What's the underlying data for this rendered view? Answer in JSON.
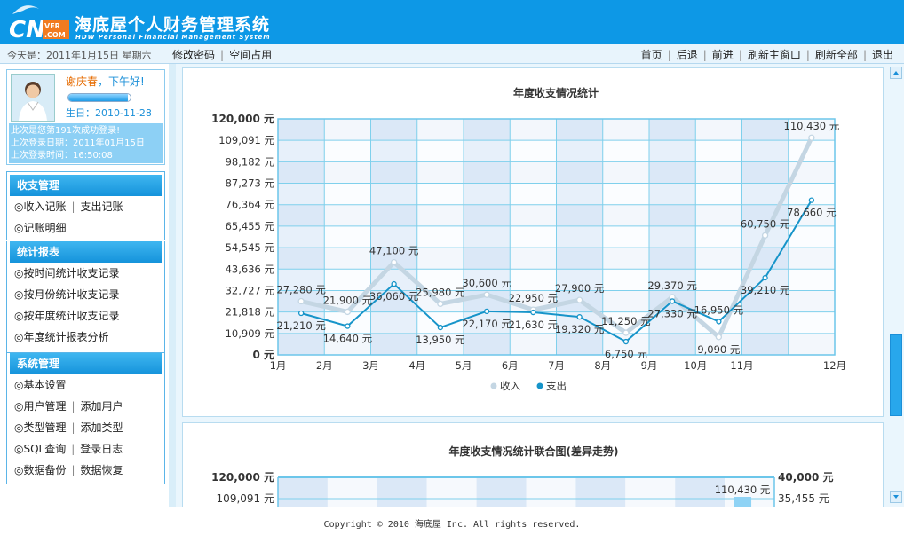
{
  "header": {
    "logo_text": "CN",
    "logo_badge": "VER.COM",
    "title": "海底屋个人财务管理系统",
    "subtitle": "HDW Personal Financial Management System"
  },
  "topbar": {
    "date": "今天是：2011年1月15日  星期六",
    "left_links": [
      "修改密码",
      "空间占用"
    ],
    "right_links": [
      "首页",
      "后退",
      "前进",
      "刷新主窗口",
      "刷新全部",
      "退出"
    ]
  },
  "user": {
    "name": "谢庆春",
    "greeting": "，下午好!",
    "birthday": "生日：2010-11-28",
    "progress": 0.95,
    "login_lines": [
      "此次是您第191次成功登录!",
      "上次登录日期：2011年01月15日",
      "上次登录时间：16:50:08"
    ]
  },
  "menus": [
    {
      "title": "收支管理",
      "rows": [
        [
          "收入记账",
          "支出记账"
        ],
        [
          "记账明细"
        ]
      ]
    },
    {
      "title": "统计报表",
      "rows": [
        [
          "按时间统计收支记录"
        ],
        [
          "按月份统计收支记录"
        ],
        [
          "按年度统计收支记录"
        ],
        [
          "年度统计报表分析"
        ]
      ]
    },
    {
      "title": "系统管理",
      "rows": [
        [
          "基本设置"
        ],
        [
          "用户管理",
          "添加用户"
        ],
        [
          "类型管理",
          "添加类型"
        ],
        [
          "SQL查询",
          "登录日志"
        ],
        [
          "数据备份",
          "数据恢复"
        ]
      ]
    }
  ],
  "colors": {
    "header": "#0d98e6",
    "income": "#c4d6e3",
    "expense": "#1694c9",
    "accent": "#1a8fd8"
  },
  "chart_data": [
    {
      "type": "line",
      "title": "年度收支情况统计",
      "categories": [
        "1月",
        "2月",
        "3月",
        "4月",
        "5月",
        "6月",
        "7月",
        "8月",
        "9月",
        "10月",
        "11月",
        "12月"
      ],
      "yticks": [
        "0 元",
        "10,909 元",
        "21,818 元",
        "32,727 元",
        "43,636 元",
        "54,545 元",
        "65,455 元",
        "76,364 元",
        "87,273 元",
        "98,182 元",
        "109,091 元",
        "120,000 元"
      ],
      "ylim": [
        0,
        120000
      ],
      "series": [
        {
          "name": "收入",
          "values": [
            27280,
            21900,
            47100,
            25980,
            30600,
            22950,
            27900,
            11250,
            29370,
            9090,
            60750,
            110430
          ],
          "labels": [
            "27,280 元",
            "21,900 元",
            "47,100 元",
            "25,980 元",
            "30,600 元",
            "22,950 元",
            "27,900 元",
            "11,250 元",
            "29,370 元",
            "9,090 元",
            "60,750 元",
            "110,430 元"
          ]
        },
        {
          "name": "支出",
          "values": [
            21210,
            14640,
            36060,
            13950,
            22170,
            21630,
            19320,
            6750,
            27330,
            16950,
            39210,
            78660
          ],
          "labels": [
            "21,210 元",
            "14,640 元",
            "36,060 元",
            "13,950 元",
            "22,170 元",
            "21,630 元",
            "19,320 元",
            "6,750 元",
            "27,330 元",
            "16,950 元",
            "39,210 元",
            "78,660 元"
          ]
        }
      ],
      "legend": "bottom",
      "grid": true
    },
    {
      "type": "bar",
      "title": "年度收支情况统计联合图(差异走势)",
      "yticks_left": [
        "120,000 元",
        "109,091 元"
      ],
      "yticks_right": [
        "40,000 元",
        "35,455 元"
      ],
      "visible_labels": [
        "110,430 元"
      ]
    }
  ],
  "footer": {
    "copyright": "Copyright © 2010 海底屋 Inc. All rights reserved."
  }
}
